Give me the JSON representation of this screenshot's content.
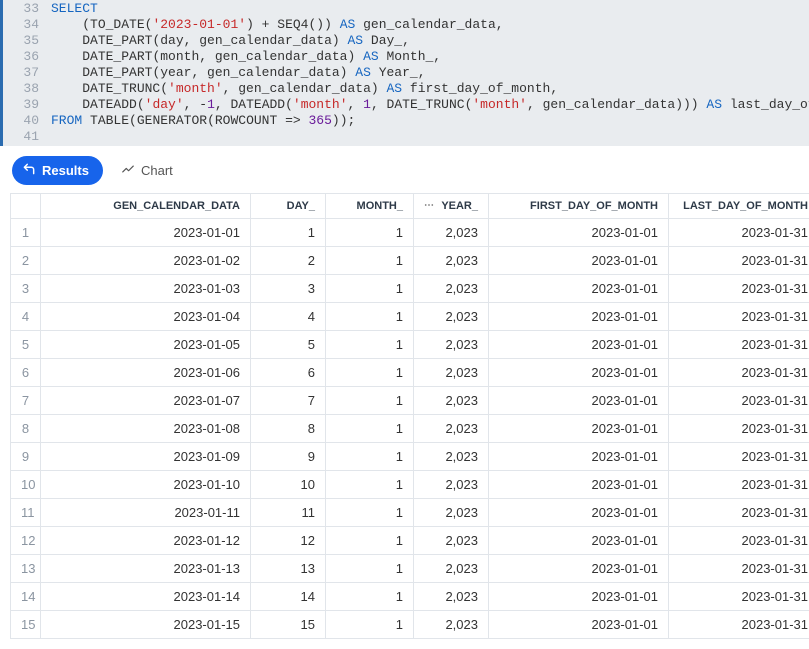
{
  "editor": {
    "lines": [
      {
        "n": 33,
        "segs": [
          [
            "kw",
            "SELECT"
          ]
        ]
      },
      {
        "n": 34,
        "segs": [
          [
            "",
            "    ("
          ],
          [
            "fn",
            "TO_DATE"
          ],
          [
            "",
            "("
          ],
          [
            "str",
            "'2023-01-01'"
          ],
          [
            "",
            ") + "
          ],
          [
            "fn",
            "SEQ4"
          ],
          [
            "",
            "()) "
          ],
          [
            "kw",
            "AS"
          ],
          [
            "",
            " gen_calendar_data,"
          ]
        ]
      },
      {
        "n": 35,
        "segs": [
          [
            "",
            "    "
          ],
          [
            "fn",
            "DATE_PART"
          ],
          [
            "",
            "(day, gen_calendar_data) "
          ],
          [
            "kw",
            "AS"
          ],
          [
            "",
            " Day_,"
          ]
        ]
      },
      {
        "n": 36,
        "segs": [
          [
            "",
            "    "
          ],
          [
            "fn",
            "DATE_PART"
          ],
          [
            "",
            "(month, gen_calendar_data) "
          ],
          [
            "kw",
            "AS"
          ],
          [
            "",
            " Month_,"
          ]
        ]
      },
      {
        "n": 37,
        "segs": [
          [
            "",
            "    "
          ],
          [
            "fn",
            "DATE_PART"
          ],
          [
            "",
            "(year, gen_calendar_data) "
          ],
          [
            "kw",
            "AS"
          ],
          [
            "",
            " Year_,"
          ]
        ]
      },
      {
        "n": 38,
        "segs": [
          [
            "",
            "    "
          ],
          [
            "fn",
            "DATE_TRUNC"
          ],
          [
            "",
            "("
          ],
          [
            "str",
            "'month'"
          ],
          [
            "",
            ", gen_calendar_data) "
          ],
          [
            "kw",
            "AS"
          ],
          [
            "",
            " first_day_of_month,"
          ]
        ]
      },
      {
        "n": 39,
        "segs": [
          [
            "",
            "    "
          ],
          [
            "fn",
            "DATEADD"
          ],
          [
            "",
            "("
          ],
          [
            "str",
            "'day'"
          ],
          [
            "",
            ", -"
          ],
          [
            "num",
            "1"
          ],
          [
            "",
            ", "
          ],
          [
            "fn",
            "DATEADD"
          ],
          [
            "",
            "("
          ],
          [
            "str",
            "'month'"
          ],
          [
            "",
            ", "
          ],
          [
            "num",
            "1"
          ],
          [
            "",
            ", "
          ],
          [
            "fn",
            "DATE_TRUNC"
          ],
          [
            "",
            "("
          ],
          [
            "str",
            "'month'"
          ],
          [
            "",
            ", gen_calendar_data))) "
          ],
          [
            "kw",
            "AS"
          ],
          [
            "",
            " last_day_of_month"
          ]
        ]
      },
      {
        "n": 40,
        "segs": [
          [
            "kw",
            "FROM"
          ],
          [
            "",
            " "
          ],
          [
            "fn",
            "TABLE"
          ],
          [
            "",
            "("
          ],
          [
            "fn",
            "GENERATOR"
          ],
          [
            "",
            "(ROWCOUNT => "
          ],
          [
            "num",
            "365"
          ],
          [
            "",
            "));"
          ]
        ]
      },
      {
        "n": 41,
        "segs": [
          [
            "",
            ""
          ]
        ]
      }
    ]
  },
  "toolbar": {
    "results_label": "Results",
    "chart_label": "Chart"
  },
  "table": {
    "columns": [
      "GEN_CALENDAR_DATA",
      "DAY_",
      "MONTH_",
      "YEAR_",
      "FIRST_DAY_OF_MONTH",
      "LAST_DAY_OF_MONTH"
    ],
    "rows": [
      {
        "n": 1,
        "gen": "2023-01-01",
        "day": "1",
        "month": "1",
        "year": "2,023",
        "fdom": "2023-01-01",
        "ldom": "2023-01-31"
      },
      {
        "n": 2,
        "gen": "2023-01-02",
        "day": "2",
        "month": "1",
        "year": "2,023",
        "fdom": "2023-01-01",
        "ldom": "2023-01-31"
      },
      {
        "n": 3,
        "gen": "2023-01-03",
        "day": "3",
        "month": "1",
        "year": "2,023",
        "fdom": "2023-01-01",
        "ldom": "2023-01-31"
      },
      {
        "n": 4,
        "gen": "2023-01-04",
        "day": "4",
        "month": "1",
        "year": "2,023",
        "fdom": "2023-01-01",
        "ldom": "2023-01-31"
      },
      {
        "n": 5,
        "gen": "2023-01-05",
        "day": "5",
        "month": "1",
        "year": "2,023",
        "fdom": "2023-01-01",
        "ldom": "2023-01-31"
      },
      {
        "n": 6,
        "gen": "2023-01-06",
        "day": "6",
        "month": "1",
        "year": "2,023",
        "fdom": "2023-01-01",
        "ldom": "2023-01-31"
      },
      {
        "n": 7,
        "gen": "2023-01-07",
        "day": "7",
        "month": "1",
        "year": "2,023",
        "fdom": "2023-01-01",
        "ldom": "2023-01-31"
      },
      {
        "n": 8,
        "gen": "2023-01-08",
        "day": "8",
        "month": "1",
        "year": "2,023",
        "fdom": "2023-01-01",
        "ldom": "2023-01-31"
      },
      {
        "n": 9,
        "gen": "2023-01-09",
        "day": "9",
        "month": "1",
        "year": "2,023",
        "fdom": "2023-01-01",
        "ldom": "2023-01-31"
      },
      {
        "n": 10,
        "gen": "2023-01-10",
        "day": "10",
        "month": "1",
        "year": "2,023",
        "fdom": "2023-01-01",
        "ldom": "2023-01-31"
      },
      {
        "n": 11,
        "gen": "2023-01-11",
        "day": "11",
        "month": "1",
        "year": "2,023",
        "fdom": "2023-01-01",
        "ldom": "2023-01-31"
      },
      {
        "n": 12,
        "gen": "2023-01-12",
        "day": "12",
        "month": "1",
        "year": "2,023",
        "fdom": "2023-01-01",
        "ldom": "2023-01-31"
      },
      {
        "n": 13,
        "gen": "2023-01-13",
        "day": "13",
        "month": "1",
        "year": "2,023",
        "fdom": "2023-01-01",
        "ldom": "2023-01-31"
      },
      {
        "n": 14,
        "gen": "2023-01-14",
        "day": "14",
        "month": "1",
        "year": "2,023",
        "fdom": "2023-01-01",
        "ldom": "2023-01-31"
      },
      {
        "n": 15,
        "gen": "2023-01-15",
        "day": "15",
        "month": "1",
        "year": "2,023",
        "fdom": "2023-01-01",
        "ldom": "2023-01-31"
      }
    ]
  }
}
